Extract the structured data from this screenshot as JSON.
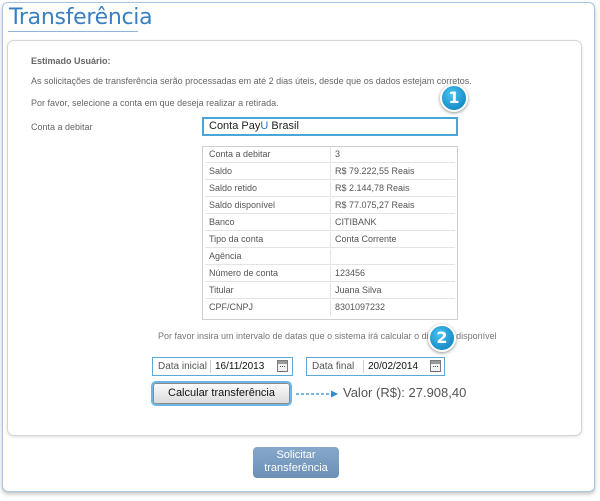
{
  "page": {
    "title": "Transferência"
  },
  "intro": {
    "greeting": "Estimado Usuário:",
    "message": "As solicitações de transferência serão processadas em até 2 dias úteis, desde que os dados estejam corretos.",
    "instruction": "Por favor, selecione a conta em que deseja realizar a retirada."
  },
  "account": {
    "label": "Conta a debitar",
    "selected_prefix": "Conta Pay",
    "selected_highlight": "U",
    "selected_suffix": " Brasil"
  },
  "details": [
    {
      "key": "Conta a debitar",
      "value": "3"
    },
    {
      "key": "Saldo",
      "value": "R$ 79.222,55 Reais"
    },
    {
      "key": "Saldo retido",
      "value": "R$ 2.144,78 Reais"
    },
    {
      "key": "Saldo disponível",
      "value": "R$ 77.075,27 Reais"
    },
    {
      "key": "Banco",
      "value": "CITIBANK"
    },
    {
      "key": "Tipo da conta",
      "value": "Conta Corrente"
    },
    {
      "key": "Agência",
      "value": ""
    },
    {
      "key": "Número de conta",
      "value": "123456"
    },
    {
      "key": "Titular",
      "value": "Juana Silva"
    },
    {
      "key": "CPF/CNPJ",
      "value": "8301097232"
    }
  ],
  "badges": {
    "one": "1",
    "two": "2"
  },
  "dates": {
    "hint": "Por favor insira um intervalo de datas que o sistema irá calcular o dinheiro disponível",
    "start_label": "Data inicial",
    "start_value": "16/11/2013",
    "end_label": "Data final",
    "end_value": "20/02/2014"
  },
  "calc": {
    "button_label": "Calcular transferência",
    "result": "Valor (R$): 27.908,40"
  },
  "submit": {
    "line1": "Solicitar",
    "line2": "transferência"
  },
  "colors": {
    "accent": "#3a7fbf",
    "highlight_border": "#4aa6d8",
    "badge": "#168ec8",
    "submit_button": "#7a9dc2"
  }
}
